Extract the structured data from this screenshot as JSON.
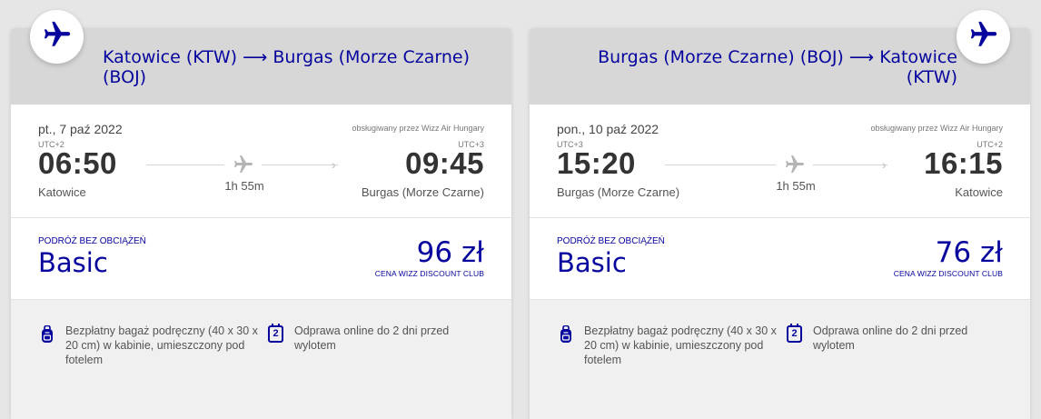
{
  "colors": {
    "brand": "#06049d",
    "header_bg": "#d7d7d7",
    "footer_bg": "#f0f0f0"
  },
  "icons": {
    "badge": "airplane-icon",
    "mid": "airplane-icon",
    "bag": "backpack-icon",
    "calendar": "calendar-icon"
  },
  "outbound": {
    "from": "Katowice (KTW)",
    "arrow": "⟶",
    "to": "Burgas (Morze Czarne) (BOJ)",
    "date": "pt., 7 paź 2022",
    "operated_by": "obsługiwany przez Wizz Air Hungary",
    "dep_tz": "UTC+2",
    "arr_tz": "UTC+3",
    "dep_time": "06:50",
    "arr_time": "09:45",
    "dep_city": "Katowice",
    "arr_city": "Burgas (Morze Czarne)",
    "duration": "1h 55m",
    "fare_subtitle": "PODRÓŻ BEZ OBCIĄŻEŃ",
    "fare_name": "Basic",
    "price": "96 zł",
    "club_label": "CENA WIZZ DISCOUNT CLUB",
    "perk_bag": "Bezpłatny bagaż podręczny (40 x 30 x 20 cm) w kabinie, umieszczony pod fotelem",
    "perk_checkin_num": "2",
    "perk_checkin": "Odprawa online do 2 dni przed wylotem"
  },
  "return": {
    "from": "Burgas (Morze Czarne) (BOJ)",
    "arrow": "⟶",
    "to": "Katowice (KTW)",
    "date": "pon., 10 paź 2022",
    "operated_by": "obsługiwany przez Wizz Air Hungary",
    "dep_tz": "UTC+3",
    "arr_tz": "UTC+2",
    "dep_time": "15:20",
    "arr_time": "16:15",
    "dep_city": "Burgas (Morze Czarne)",
    "arr_city": "Katowice",
    "duration": "1h 55m",
    "fare_subtitle": "PODRÓŻ BEZ OBCIĄŻEŃ",
    "fare_name": "Basic",
    "price": "76 zł",
    "club_label": "CENA WIZZ DISCOUNT CLUB",
    "perk_bag": "Bezpłatny bagaż podręczny (40 x 30 x 20 cm) w kabinie, umieszczony pod fotelem",
    "perk_checkin_num": "2",
    "perk_checkin": "Odprawa online do 2 dni przed wylotem"
  }
}
